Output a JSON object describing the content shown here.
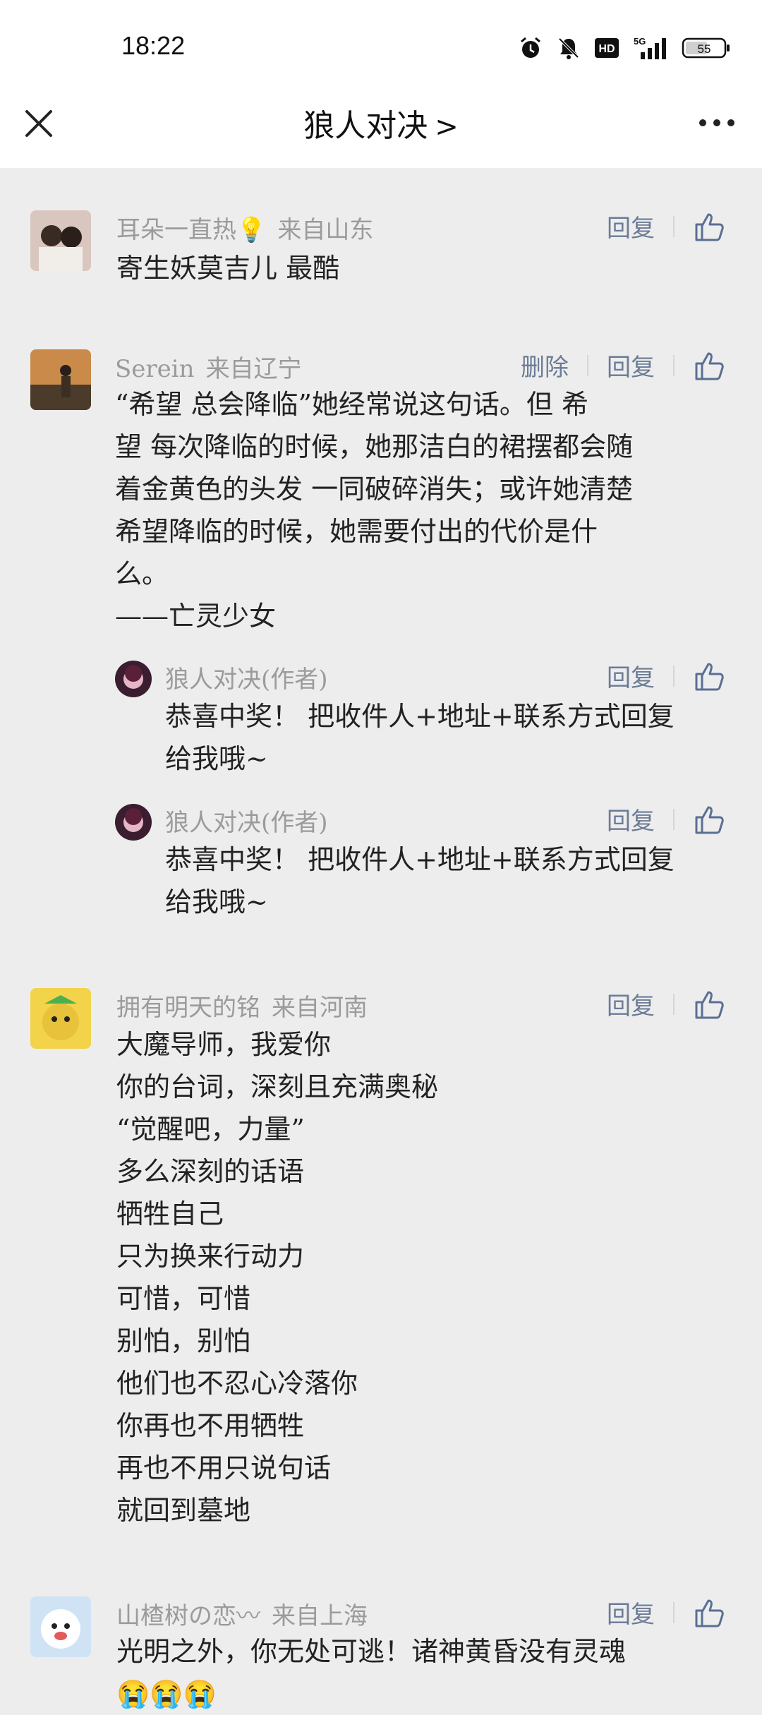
{
  "status_bar": {
    "time": "18:22",
    "network": "5G",
    "hd": "HD",
    "battery": "55",
    "icons": [
      "alarm-icon",
      "mute-icon",
      "hd-icon",
      "signal-5g-icon",
      "battery-icon"
    ]
  },
  "nav": {
    "title": "狼人对决",
    "chevron": ">",
    "close_icon": "close-icon",
    "more_icon": "more-icon"
  },
  "actions": {
    "reply": "回复",
    "delete": "删除"
  },
  "comments": [
    {
      "author": "耳朵一直热💡",
      "location": "来自山东",
      "text": "寄生妖莫吉儿 最酷"
    },
    {
      "author": "Serein",
      "location": "来自辽宁",
      "text": "“希望 总会降临”她经常说这句话。但 希\n望 每次降临的时候，她那洁白的裙摆都会随\n着金黄色的头发 一同破碎消失；或许她清楚\n希望降临的时候，她需要付出的代价是什\n么。\n——亡灵少女",
      "replies": [
        {
          "author": "狼人对决(作者)",
          "text": "恭喜中奖！ 把收件人+地址+联系方式回复\n给我哦~"
        },
        {
          "author": "狼人对决(作者)",
          "text": "恭喜中奖！ 把收件人+地址+联系方式回复\n给我哦~"
        }
      ]
    },
    {
      "author": "拥有明天的铭",
      "location": "来自河南",
      "text": "大魔导师，我爱你\n你的台词，深刻且充满奥秘\n“觉醒吧，力量”\n多么深刻的话语\n牺牲自己\n只为换来行动力\n可惜，可惜\n别怕，别怕\n他们也不忍心冷落你\n你再也不用牺牲\n再也不用只说句话\n就回到墓地"
    },
    {
      "author": "山楂树の恋〰",
      "location": "来自上海",
      "text": "光明之外，你无处可逃！诸神黄昏没有灵魂\n😭😭😭"
    }
  ]
}
